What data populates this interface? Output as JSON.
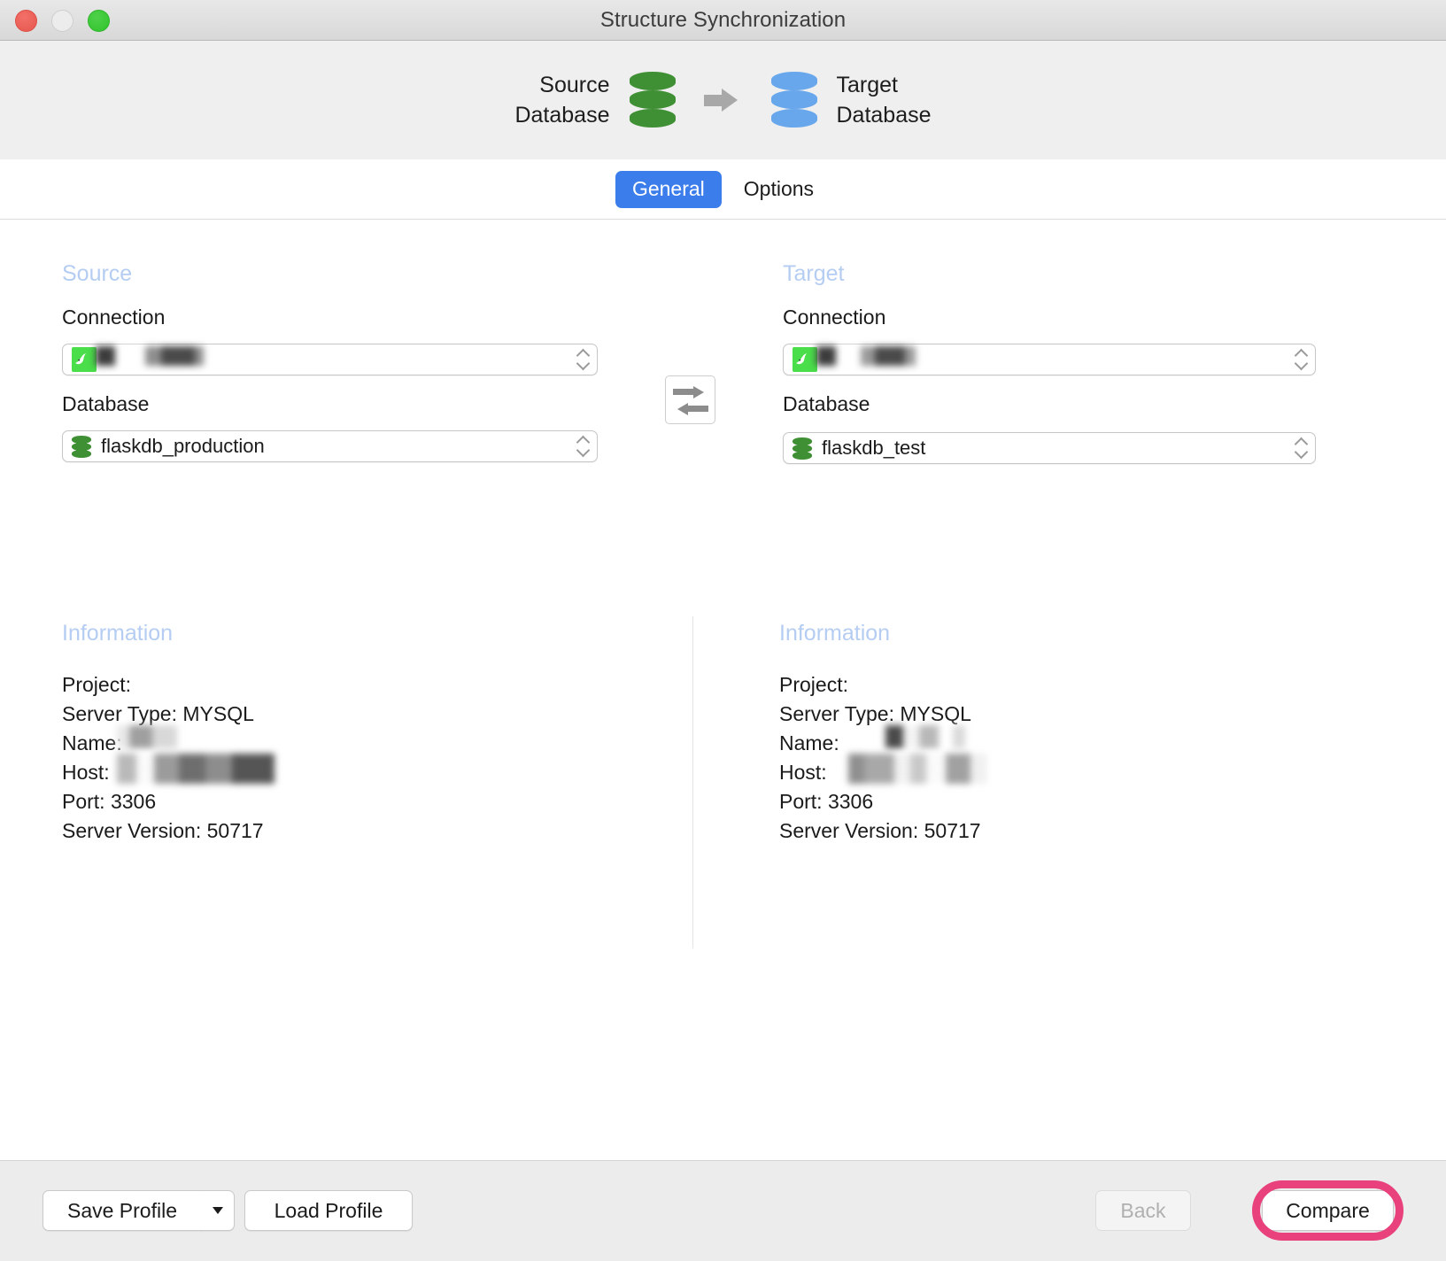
{
  "window": {
    "title": "Structure Synchronization",
    "traffic_lights": [
      "close",
      "minimize",
      "maximize"
    ]
  },
  "header": {
    "source_label": "Source\nDatabase",
    "target_label": "Target\nDatabase",
    "source_icon": "database-cylinder-green-icon",
    "target_icon": "database-cylinder-blue-icon",
    "arrow_icon": "arrow-right-icon",
    "source_color": "#3f8f34",
    "target_color": "#68a7ec"
  },
  "tabs": [
    {
      "label": "General",
      "active": true
    },
    {
      "label": "Options",
      "active": false
    }
  ],
  "accent_color": "#3b7deb",
  "highlight_color": "#e8417b",
  "source": {
    "section_title": "Source",
    "connection_label": "Connection",
    "connection_value": "",
    "connection_icon": "mysql-dolphin-icon",
    "database_label": "Database",
    "database_value": "flaskdb_production",
    "database_icon": "database-cylinder-icon",
    "information_title": "Information",
    "info": {
      "project": "Project:",
      "server_type": "Server Type: MYSQL",
      "name": "Name:",
      "host": "Host:",
      "port": "Port: 3306",
      "server_version": "Server Version: 50717"
    }
  },
  "target": {
    "section_title": "Target",
    "connection_label": "Connection",
    "connection_value": "",
    "connection_icon": "mysql-dolphin-icon",
    "database_label": "Database",
    "database_value": "flaskdb_test",
    "database_icon": "database-cylinder-icon",
    "information_title": "Information",
    "info": {
      "project": "Project:",
      "server_type": "Server Type: MYSQL",
      "name": "Name:",
      "host": "Host:",
      "port": "Port: 3306",
      "server_version": "Server Version: 50717"
    }
  },
  "swap": {
    "icon": "swap-arrows-icon"
  },
  "footer": {
    "save_profile_label": "Save Profile",
    "save_profile_menu_icon": "chevron-down-icon",
    "load_profile_label": "Load Profile",
    "back_label": "Back",
    "back_disabled": true,
    "compare_label": "Compare",
    "compare_highlighted": true
  }
}
